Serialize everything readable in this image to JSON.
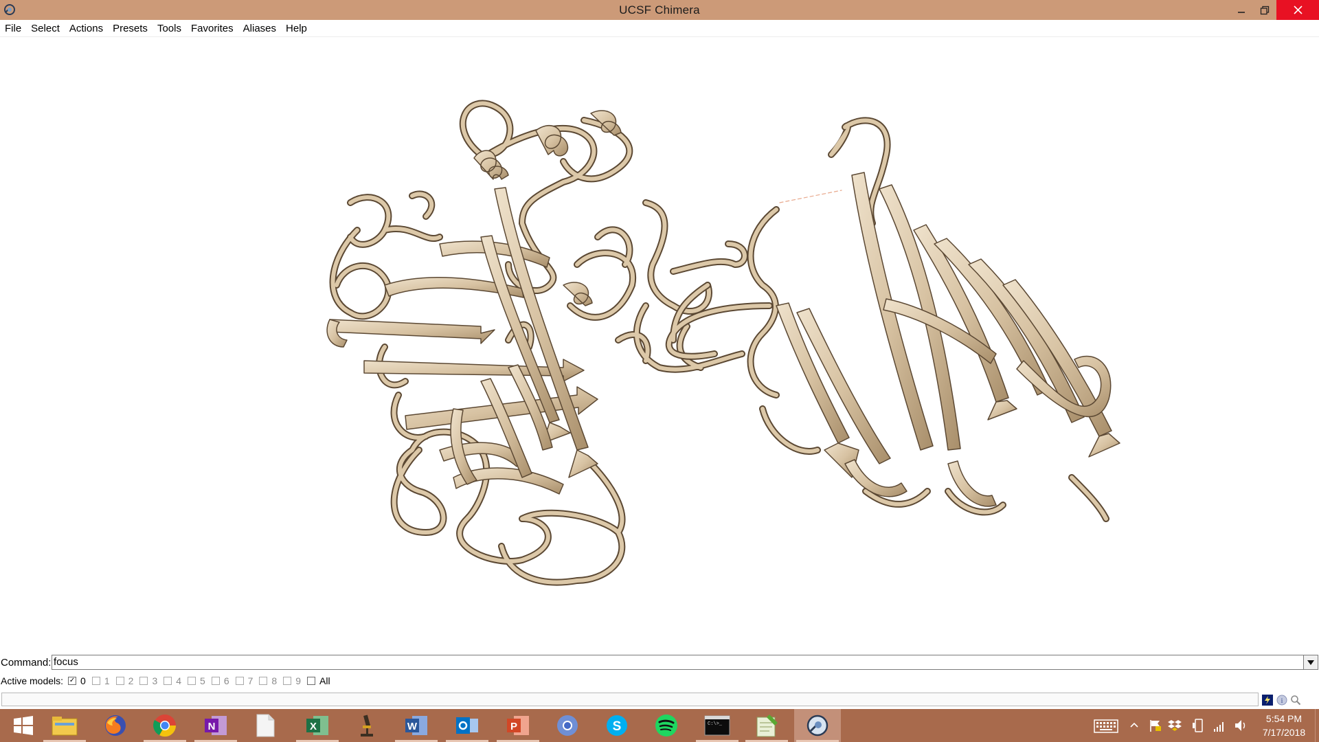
{
  "window": {
    "title": "UCSF Chimera",
    "titlebar_color": "#cc9a78",
    "close_color": "#e81123"
  },
  "menu": [
    "File",
    "Select",
    "Actions",
    "Presets",
    "Tools",
    "Favorites",
    "Aliases",
    "Help"
  ],
  "viewer": {
    "background": "#ffffff",
    "ribbon_color": "#d7c2a2",
    "structure": "protein-ribbon-cartoon"
  },
  "command": {
    "label": "Command:",
    "value": "focus"
  },
  "active_models": {
    "label": "Active models:",
    "models": [
      {
        "id": "0",
        "checked": true,
        "enabled": true
      },
      {
        "id": "1",
        "checked": false,
        "enabled": false
      },
      {
        "id": "2",
        "checked": false,
        "enabled": false
      },
      {
        "id": "3",
        "checked": false,
        "enabled": false
      },
      {
        "id": "4",
        "checked": false,
        "enabled": false
      },
      {
        "id": "5",
        "checked": false,
        "enabled": false
      },
      {
        "id": "6",
        "checked": false,
        "enabled": false
      },
      {
        "id": "7",
        "checked": false,
        "enabled": false
      },
      {
        "id": "8",
        "checked": false,
        "enabled": false
      },
      {
        "id": "9",
        "checked": false,
        "enabled": false
      },
      {
        "id": "All",
        "checked": false,
        "enabled": true
      }
    ]
  },
  "status": {
    "icons": [
      "flash-icon",
      "info-icon",
      "magnifier-icon"
    ]
  },
  "taskbar": {
    "background": "#a86a4c",
    "apps": [
      {
        "name": "start",
        "icon": "windows-logo-icon"
      },
      {
        "name": "file-explorer",
        "icon": "folder-icon"
      },
      {
        "name": "firefox",
        "icon": "firefox-icon"
      },
      {
        "name": "chrome",
        "icon": "chrome-icon"
      },
      {
        "name": "onenote",
        "icon": "onenote-icon"
      },
      {
        "name": "blank-document",
        "icon": "document-icon"
      },
      {
        "name": "excel",
        "icon": "excel-icon"
      },
      {
        "name": "microscope-app",
        "icon": "microscope-icon"
      },
      {
        "name": "word",
        "icon": "word-icon"
      },
      {
        "name": "outlook",
        "icon": "outlook-icon"
      },
      {
        "name": "powerpoint",
        "icon": "powerpoint-icon"
      },
      {
        "name": "chrome-app",
        "icon": "chrome-app-icon"
      },
      {
        "name": "skype",
        "icon": "skype-icon"
      },
      {
        "name": "spotify",
        "icon": "spotify-icon"
      },
      {
        "name": "terminal",
        "icon": "terminal-icon"
      },
      {
        "name": "notepad-plus",
        "icon": "notepad-icon"
      },
      {
        "name": "chimera",
        "icon": "chimera-icon"
      }
    ],
    "clock": {
      "time": "5:54 PM",
      "date": "7/17/2018"
    }
  }
}
